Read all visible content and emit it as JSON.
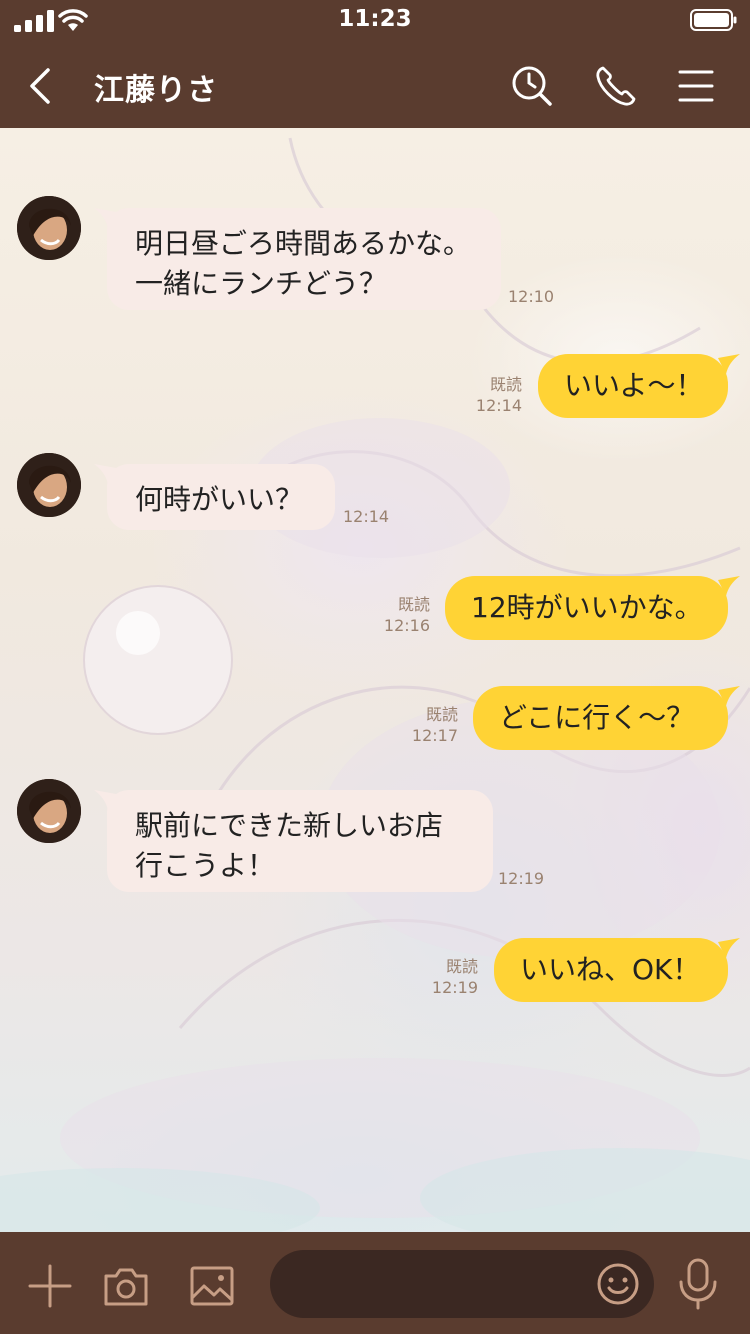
{
  "status_bar": {
    "time": "11:23"
  },
  "header": {
    "contact_name": "江藤りさ"
  },
  "messages": [
    {
      "direction": "in",
      "lines": [
        "明日昼ごろ時間あるかな。",
        "一緒にランチどう？"
      ],
      "time": "12:10"
    },
    {
      "direction": "out",
      "text": "いいよ～！",
      "read": "既読",
      "time": "12:14"
    },
    {
      "direction": "in",
      "lines": [
        "何時がいい？"
      ],
      "time": "12:14"
    },
    {
      "direction": "out",
      "text": "12時がいいかな。",
      "read": "既読",
      "time": "12:16"
    },
    {
      "direction": "out",
      "text": "どこに行く～？",
      "read": "既読",
      "time": "12:17"
    },
    {
      "direction": "in",
      "lines": [
        "駅前にできた新しいお店",
        "行こうよ！"
      ],
      "time": "12:19"
    },
    {
      "direction": "out",
      "text": "いいね、OK！",
      "read": "既読",
      "time": "12:19"
    }
  ],
  "icons": {
    "back": "chevron-left-icon",
    "search": "clock-search-icon",
    "call": "phone-icon",
    "menu": "menu-icon",
    "add": "plus-icon",
    "camera": "camera-icon",
    "image": "image-icon",
    "emoji": "smiley-icon",
    "mic": "microphone-icon"
  },
  "colors": {
    "bar": "#5a3c2f",
    "incoming_bubble": "#f8ebe7",
    "outgoing_bubble": "#ffd335",
    "meta_text": "#9a8270"
  }
}
